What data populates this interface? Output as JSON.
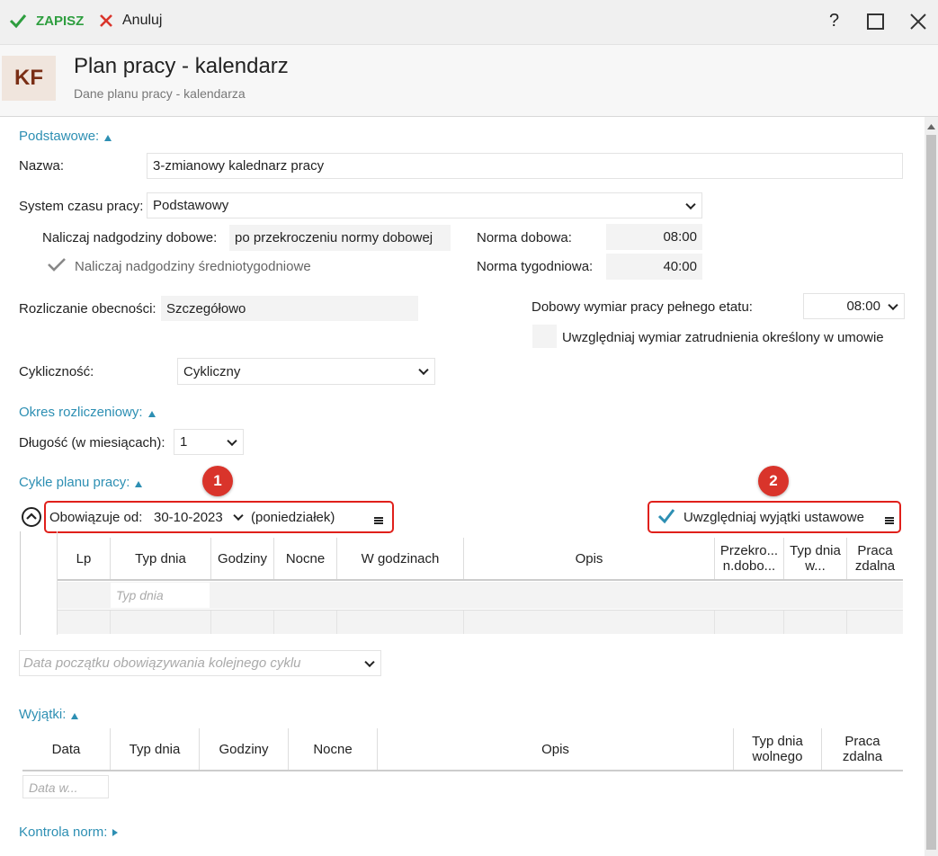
{
  "toolbar": {
    "save_label": "ZAPISZ",
    "cancel_label": "Anuluj",
    "help_label": "?"
  },
  "header": {
    "avatar_initials": "KF",
    "title": "Plan pracy - kalendarz",
    "subtitle": "Dane planu pracy - kalendarza"
  },
  "podstawowe": {
    "section_label": "Podstawowe:",
    "nazwa_label": "Nazwa:",
    "nazwa_value": "3-zmianowy kalednarz pracy",
    "system_label": "System czasu pracy:",
    "system_value": "Podstawowy",
    "naliczaj_label": "Naliczaj nadgodziny dobowe:",
    "naliczaj_value": "po przekroczeniu normy dobowej",
    "srednio_label": "Naliczaj nadgodziny średniotygodniowe",
    "norma_dobowa_label": "Norma dobowa:",
    "norma_dobowa_value": "08:00",
    "norma_tyg_label": "Norma tygodniowa:",
    "norma_tyg_value": "40:00",
    "rozliczanie_label": "Rozliczanie obecności:",
    "rozliczanie_value": "Szczegółowo",
    "dobowy_label": "Dobowy wymiar pracy pełnego etatu:",
    "dobowy_value": "08:00",
    "uwzgl_wymiar_label": "Uwzględniaj wymiar zatrudnienia określony w umowie",
    "cyklicznosc_label": "Cykliczność:",
    "cyklicznosc_value": "Cykliczny"
  },
  "okres": {
    "section_label": "Okres rozliczeniowy:",
    "dlugosc_label": "Długość (w miesiącach):",
    "dlugosc_value": "1"
  },
  "cykle": {
    "section_label": "Cykle planu pracy:",
    "badge1": "1",
    "badge2": "2",
    "obowiazuje_label": "Obowiązuje od:",
    "obowiazuje_date": "30-10-2023",
    "obowiazuje_day": "(poniedziałek)",
    "uwzgl_wyjatki_label": "Uwzględniaj wyjątki ustawowe",
    "columns": [
      "Lp",
      "Typ dnia",
      "Godziny",
      "Nocne",
      "W godzinach",
      "Opis",
      "Przekro... n.dobo...",
      "Typ dnia w...",
      "Praca zdalna"
    ],
    "typ_dnia_placeholder": "Typ dnia",
    "kolejny_placeholder": "Data początku obowiązywania kolejnego cyklu"
  },
  "wyjatki": {
    "section_label": "Wyjątki:",
    "columns": [
      "Data",
      "Typ dnia",
      "Godziny",
      "Nocne",
      "Opis",
      "Typ dnia wolnego",
      "Praca zdalna"
    ],
    "data_placeholder": "Data w..."
  },
  "kontrola": {
    "section_label": "Kontrola norm:"
  },
  "colors": {
    "accent": "#2d8fb3",
    "save_green": "#2e9e3f",
    "cancel_red": "#d9342b",
    "annotation_red": "#e0201b"
  }
}
